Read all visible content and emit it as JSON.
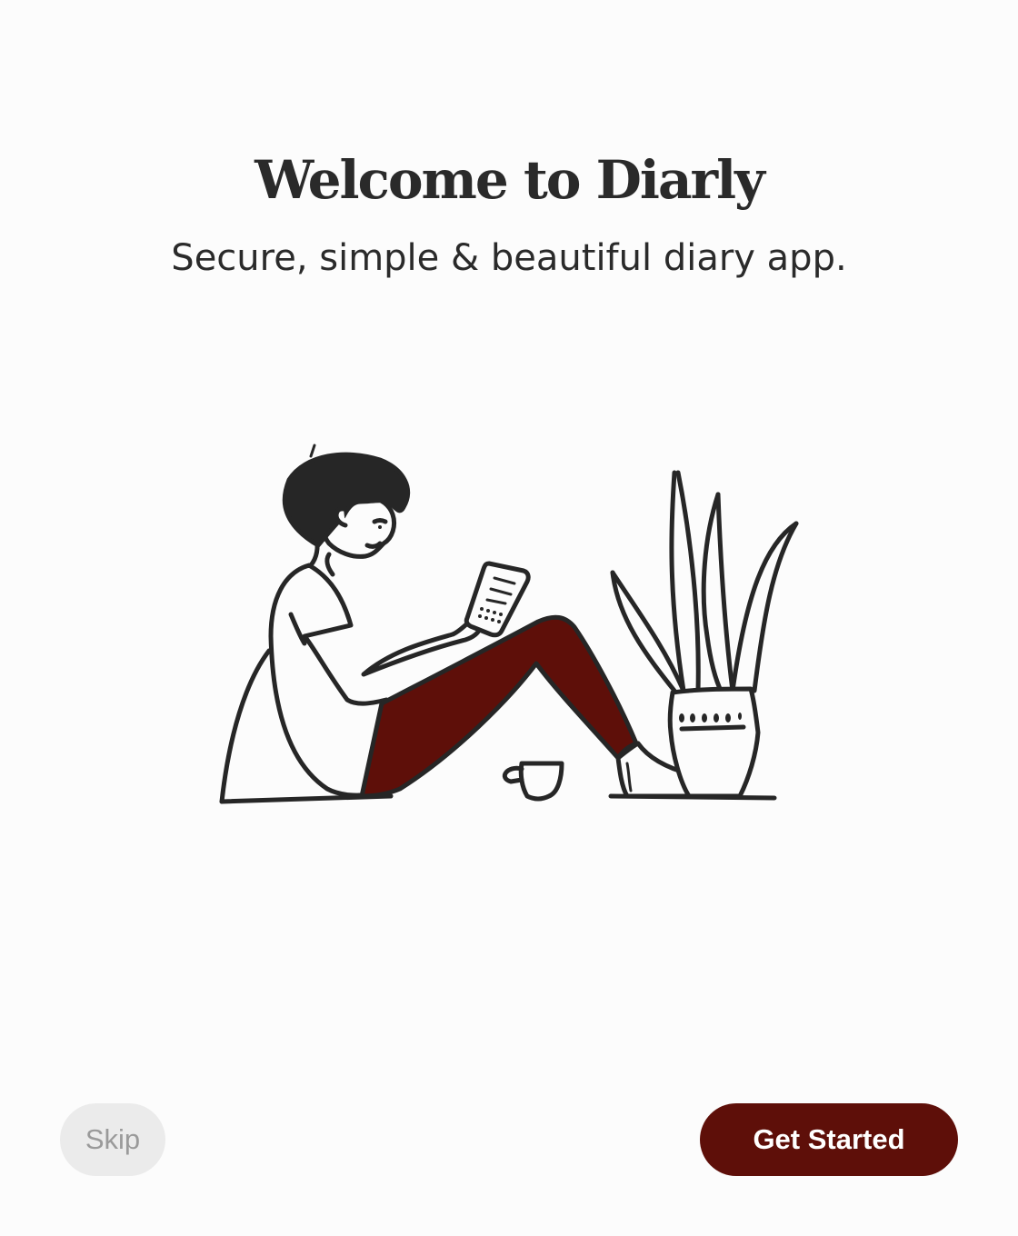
{
  "onboarding": {
    "title": "Welcome to Diarly",
    "subtitle": "Secure, simple & beautiful diary app.",
    "illustration_icon": "person-reading-phone-with-plant-illustration",
    "skip_label": "Skip",
    "primary_label": "Get Started"
  },
  "colors": {
    "background": "#fcfcfc",
    "accent": "#5e0f09",
    "text": "#2a2a2a",
    "skip_background": "#ebebeb",
    "skip_text": "#9a9a9a"
  }
}
